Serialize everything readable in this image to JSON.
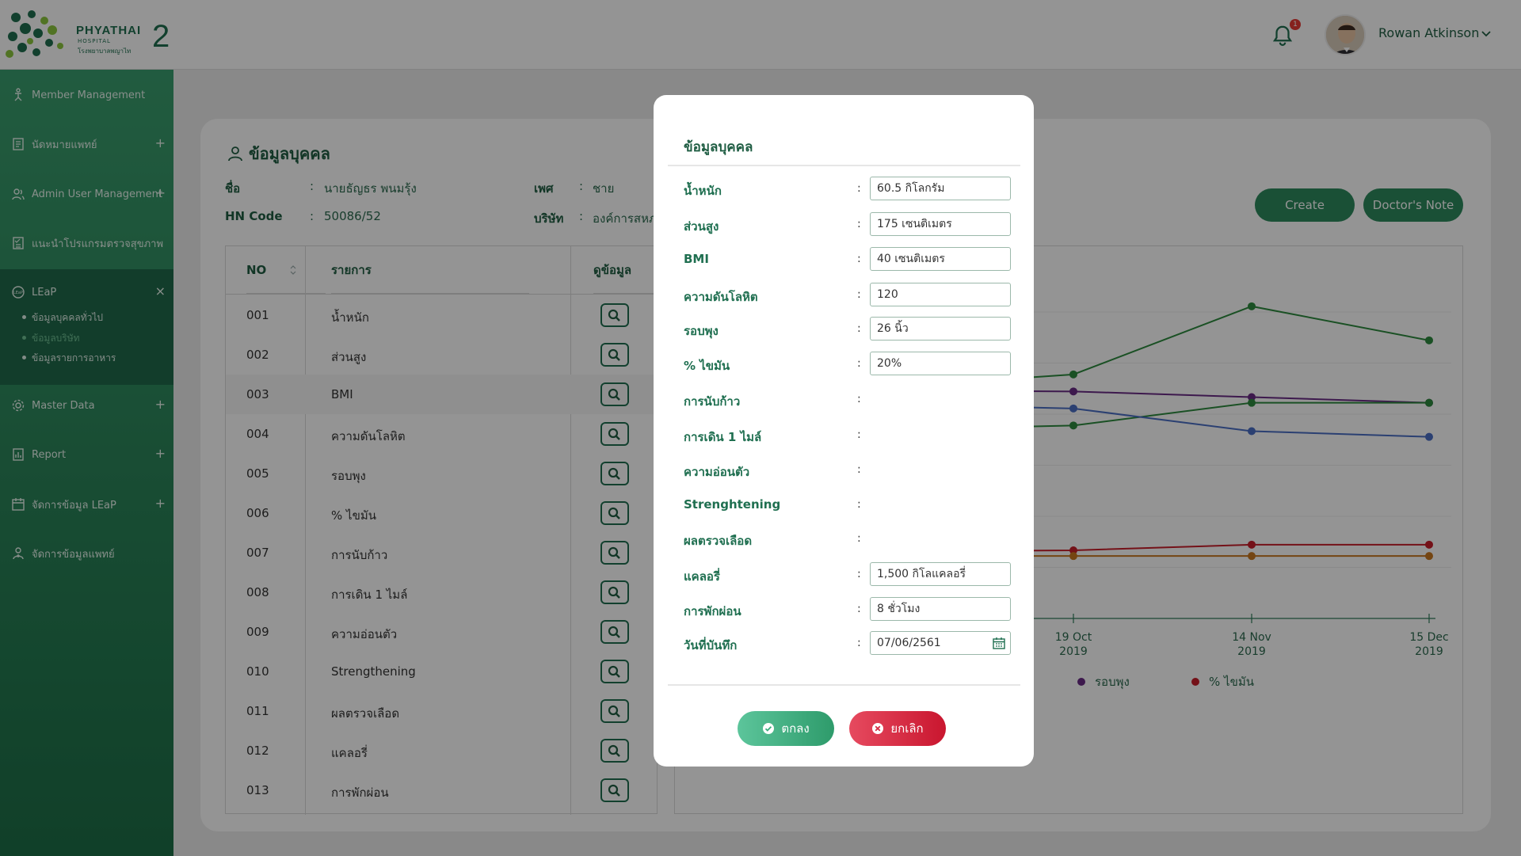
{
  "header": {
    "brand": "PHYATHAI",
    "brand_sub": "HOSPITAL",
    "brand_thai": "โรงพยาบาลพญาไท",
    "brand_number": "2",
    "notification_count": "1",
    "user_name": "Rowan Atkinson"
  },
  "sidebar": {
    "items": [
      {
        "label": "Member Management",
        "icon": "accessibility-icon",
        "expand": ""
      },
      {
        "label": "นัดหมายแพทย์",
        "icon": "document-icon",
        "expand": "+"
      },
      {
        "label": "Admin User Management",
        "icon": "users-icon",
        "expand": "+"
      },
      {
        "label": "แนะนำโปรแกรมตรวจสุขภาพ",
        "icon": "checklist-icon",
        "expand": ""
      },
      {
        "label": "LEaP",
        "icon": "leap-icon",
        "expand": "×"
      },
      {
        "label": "Master Data",
        "icon": "gear-icon",
        "expand": "+"
      },
      {
        "label": "Report",
        "icon": "report-icon",
        "expand": "+"
      },
      {
        "label": "จัดการข้อมูล LEaP",
        "icon": "calendar-icon",
        "expand": "+"
      },
      {
        "label": "จัดการข้อมูลแพทย์",
        "icon": "doctor-icon",
        "expand": ""
      }
    ],
    "sub_items": [
      "ข้อมูลบุคคลทั่วไป",
      "ข้อมูลบริษัท",
      "ข้อมูลรายการอาหาร"
    ]
  },
  "profile": {
    "title": "ข้อมูลบุคคล",
    "name_label": "ชื่อ",
    "name_value": "นายธัญธร พนมรุ้ง",
    "gender_label": "เพศ",
    "gender_value": "ชาย",
    "hn_label": "HN Code",
    "hn_value": "50086/52",
    "company_label": "บริษัท",
    "company_value": "องค์การสหภ"
  },
  "actions": {
    "create": "Create",
    "doctor_note": "Doctor's Note"
  },
  "table": {
    "headers": {
      "no": "NO",
      "item": "รายการ",
      "view": "ดูข้อมูล"
    },
    "rows": [
      {
        "no": "001",
        "name": "น้ำหนัก"
      },
      {
        "no": "002",
        "name": "ส่วนสูง"
      },
      {
        "no": "003",
        "name": "BMI"
      },
      {
        "no": "004",
        "name": "ความดันโลหิต"
      },
      {
        "no": "005",
        "name": "รอบพุง"
      },
      {
        "no": "006",
        "name": "% ไขมัน"
      },
      {
        "no": "007",
        "name": "การนับก้าว"
      },
      {
        "no": "008",
        "name": "การเดิน 1 ไมล์"
      },
      {
        "no": "009",
        "name": "ความอ่อนตัว"
      },
      {
        "no": "010",
        "name": "Strengthening"
      },
      {
        "no": "011",
        "name": "ผลตรวจเลือด"
      },
      {
        "no": "012",
        "name": "แคลอรี่"
      },
      {
        "no": "013",
        "name": "การพักผ่อน"
      }
    ]
  },
  "chart_data": {
    "type": "line",
    "categories": [
      "19 Oct 2019",
      "14 Nov 2019",
      "15 Dec 2019"
    ],
    "legend_visible": [
      "รอบพุง",
      "% ไขมัน"
    ],
    "series": [
      {
        "color": "#2e8b3e",
        "values": [
          83,
          95,
          89
        ]
      },
      {
        "color": "#6a2c86",
        "values": [
          80,
          79,
          78
        ]
      },
      {
        "color": "#2e8b3e",
        "values": [
          74,
          78,
          78
        ]
      },
      {
        "color": "#4a6ec4",
        "values": [
          77,
          73,
          72
        ]
      },
      {
        "name": "% ไขมัน",
        "color": "#c81e2a",
        "values": [
          52,
          53,
          53
        ]
      },
      {
        "color": "#c87820",
        "values": [
          51,
          51,
          51
        ]
      }
    ],
    "series_colors_legend": {
      "rop_pung": "#6a2c86",
      "fat": "#c81e2a"
    }
  },
  "modal": {
    "title": "ข้อมูลบุคคล",
    "colon": ":",
    "fields": [
      {
        "label": "น้ำหนัก",
        "value": "60.5 กิโลกรัม"
      },
      {
        "label": "ส่วนสูง",
        "value": "175 เซนติเมตร"
      },
      {
        "label": "BMI",
        "value": "40 เซนติเมตร"
      },
      {
        "label": "ความดันโลหิต",
        "value": "120"
      },
      {
        "label": "รอบพุง",
        "value": "26 นิ้ว"
      },
      {
        "label": "% ไขมัน",
        "value": "20%"
      },
      {
        "label": "การนับก้าว",
        "value": ""
      },
      {
        "label": "การเดิน 1 ไมล์",
        "value": ""
      },
      {
        "label": "ความอ่อนตัว",
        "value": ""
      },
      {
        "label": "Strenghtening",
        "value": ""
      },
      {
        "label": "ผลตรวจเลือด",
        "value": ""
      },
      {
        "label": "แคลอรี่",
        "value": "1,500 กิโลแคลอรี่"
      },
      {
        "label": "การพักผ่อน",
        "value": "8 ชั่วโมง"
      },
      {
        "label": "วันที่บันทึก",
        "value": "07/06/2561"
      }
    ],
    "ok_label": "ตกลง",
    "cancel_label": "ยกเลิก"
  }
}
